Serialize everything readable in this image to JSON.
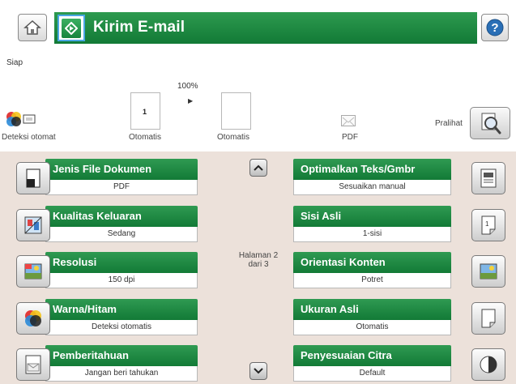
{
  "header": {
    "title": "Kirim E-mail",
    "home_icon": "home-icon",
    "start_icon": "start-icon",
    "help_icon": "help-icon"
  },
  "status": {
    "text": "Siap",
    "zoom": "100%"
  },
  "preview": {
    "color_mode_caption": "Deteksi otomat",
    "page_number": "1",
    "tray1_caption": "Otomatis",
    "tray2_caption": "Otomatis",
    "file_type_caption": "PDF",
    "pralihat_label": "Pralihat"
  },
  "options_left": [
    {
      "label": "Jenis File Dokumen",
      "value": "PDF",
      "icon": "document-icon"
    },
    {
      "label": "Kualitas Keluaran",
      "value": "Sedang",
      "icon": "quality-icon"
    },
    {
      "label": "Resolusi",
      "value": "150 dpi",
      "icon": "resolution-icon"
    },
    {
      "label": "Warna/Hitam",
      "value": "Deteksi otomatis",
      "icon": "color-icon"
    },
    {
      "label": "Pemberitahuan",
      "value": "Jangan beri tahukan",
      "icon": "notification-icon"
    }
  ],
  "options_right": [
    {
      "label": "Optimalkan Teks/Gmbr",
      "value": "Sesuaikan manual",
      "icon": "optimize-icon"
    },
    {
      "label": "Sisi Asli",
      "value": "1-sisi",
      "icon": "sides-icon"
    },
    {
      "label": "Orientasi Konten",
      "value": "Potret",
      "icon": "orientation-icon"
    },
    {
      "label": "Ukuran Asli",
      "value": "Otomatis",
      "icon": "original-size-icon"
    },
    {
      "label": "Penyesuaian Citra",
      "value": "Default",
      "icon": "image-adjust-icon"
    }
  ],
  "pagination": {
    "line1": "Halaman 2",
    "line2": "dari 3"
  },
  "colors": {
    "green": "#17843d",
    "panel_bg": "#ece1da",
    "start_border": "#4aa7e4"
  }
}
